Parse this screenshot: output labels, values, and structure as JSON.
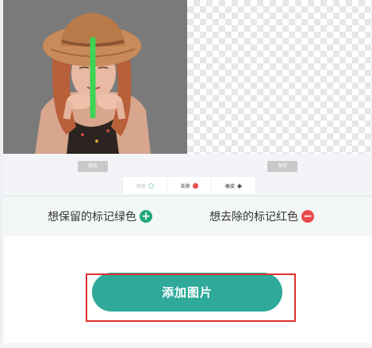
{
  "editor": {
    "left_panel": "original-image",
    "right_panel": "transparent-preview",
    "preview_button": "预览",
    "save_button": "保存",
    "tools": [
      {
        "label": "保留",
        "icon": "keep-dot-icon",
        "active": true
      },
      {
        "label": "去除",
        "icon": "remove-dot-icon",
        "active": false
      },
      {
        "label": "橡皮",
        "icon": "eraser-icon",
        "active": false
      }
    ]
  },
  "hints": {
    "keep_text": "想保留的标记绿色",
    "remove_text": "想去除的标记红色"
  },
  "add_image_button": "添加图片",
  "colors": {
    "accent": "#2ea99a",
    "keep_green": "#1fa67a",
    "remove_red": "#e84a4a",
    "highlight": "#e0302e"
  }
}
